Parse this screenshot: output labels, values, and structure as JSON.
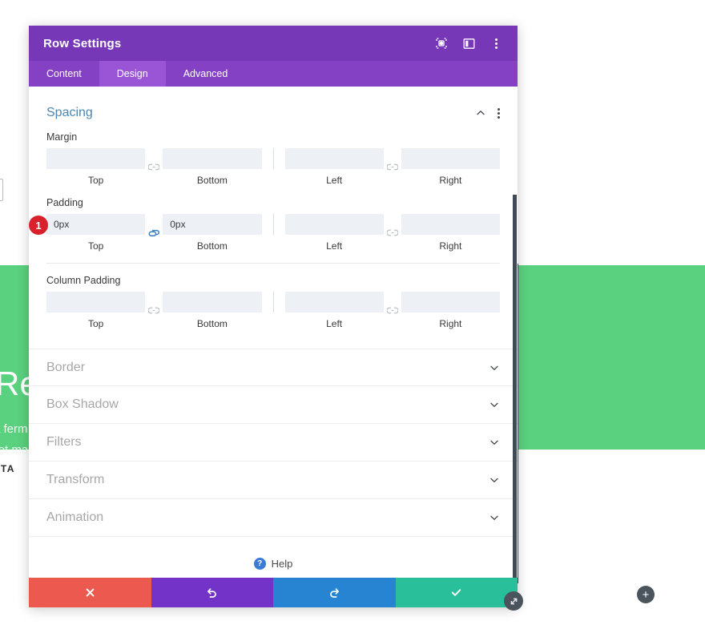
{
  "background": {
    "heading": "Rem",
    "sub_line1": "a ferm",
    "sub_line2": "s et ma",
    "cta": "T STA",
    "add_button": "+",
    "green": "#5ad17e"
  },
  "modal": {
    "title": "Row Settings",
    "header_icons": [
      {
        "name": "focus-target-icon",
        "glyph": "focus"
      },
      {
        "name": "layout-panel-icon",
        "glyph": "panel"
      },
      {
        "name": "more-options-icon",
        "glyph": "kebab"
      }
    ],
    "tabs": [
      {
        "label": "Content",
        "active": false
      },
      {
        "label": "Design",
        "active": true
      },
      {
        "label": "Advanced",
        "active": false
      }
    ],
    "spacing": {
      "title": "Spacing",
      "collapse_icon": "chevron-up-icon",
      "options_icon": "more-options-icon",
      "groups": [
        {
          "label": "Margin",
          "badge": null,
          "link_left": "unlinked",
          "link_right": "unlinked",
          "fields": [
            {
              "sub": "Top",
              "value": "",
              "placeholder": ""
            },
            {
              "sub": "Bottom",
              "value": "",
              "placeholder": ""
            },
            {
              "sub": "Left",
              "value": "",
              "placeholder": ""
            },
            {
              "sub": "Right",
              "value": "",
              "placeholder": ""
            }
          ]
        },
        {
          "label": "Padding",
          "badge": "1",
          "link_left": "linked",
          "link_right": "unlinked",
          "fields": [
            {
              "sub": "Top",
              "value": "0px",
              "placeholder": ""
            },
            {
              "sub": "Bottom",
              "value": "0px",
              "placeholder": ""
            },
            {
              "sub": "Left",
              "value": "",
              "placeholder": ""
            },
            {
              "sub": "Right",
              "value": "",
              "placeholder": ""
            }
          ]
        },
        {
          "label": "Column Padding",
          "badge": null,
          "link_left": "unlinked",
          "link_right": "unlinked",
          "fields": [
            {
              "sub": "Top",
              "value": "",
              "placeholder": ""
            },
            {
              "sub": "Bottom",
              "value": "",
              "placeholder": ""
            },
            {
              "sub": "Left",
              "value": "",
              "placeholder": ""
            },
            {
              "sub": "Right",
              "value": "",
              "placeholder": ""
            }
          ]
        }
      ]
    },
    "accordions": [
      {
        "label": "Border"
      },
      {
        "label": "Box Shadow"
      },
      {
        "label": "Filters"
      },
      {
        "label": "Transform"
      },
      {
        "label": "Animation"
      }
    ],
    "help": {
      "label": "Help",
      "icon": "question-mark-icon"
    },
    "footer": [
      {
        "name": "cancel-button",
        "icon": "close-icon",
        "color": "#ec5a4f"
      },
      {
        "name": "undo-button",
        "icon": "undo-icon",
        "color": "#7333c8"
      },
      {
        "name": "redo-button",
        "icon": "redo-icon",
        "color": "#2784d3"
      },
      {
        "name": "save-button",
        "icon": "check-icon",
        "color": "#29bf9b"
      }
    ],
    "colors": {
      "header": "#7638b6",
      "tabbar": "#8541c4",
      "tab_active": "#9a55d6",
      "section_title": "#4b86b4",
      "badge": "#d9212b"
    }
  }
}
